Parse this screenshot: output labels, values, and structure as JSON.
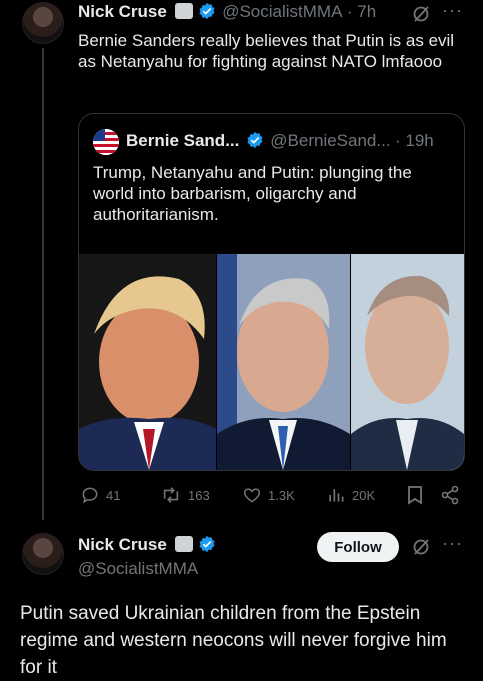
{
  "tweet1": {
    "author_name": "Nick Cruse",
    "handle": "@SocialistMMA",
    "time": "· 7h",
    "text": "Bernie Sanders really believes that Putin is as evil as Netanyahu for fighting against NATO lmfaooo"
  },
  "quote": {
    "author_name": "Bernie Sand...",
    "handle": "@BernieSand...",
    "time": "· 19h",
    "text": "Trump, Netanyahu and Putin: plunging the world into barbarism, oligarchy and authoritarianism."
  },
  "actions": {
    "replies": "41",
    "reposts": "163",
    "likes": "1.3K",
    "views": "20K"
  },
  "tweet2": {
    "author_name": "Nick Cruse",
    "handle": "@SocialistMMA",
    "follow_label": "Follow",
    "text": "Putin saved Ukrainian children from the Epstein regime and western neocons will never forgive him for it"
  },
  "colors": {
    "background": "#000000",
    "text": "#e7e9ea",
    "muted": "#71767b",
    "verified": "#1d9bf0"
  },
  "icons": [
    "verified-icon",
    "grok-icon",
    "more-icon",
    "reply-icon",
    "repost-icon",
    "like-icon",
    "views-icon",
    "bookmark-icon",
    "share-icon"
  ]
}
